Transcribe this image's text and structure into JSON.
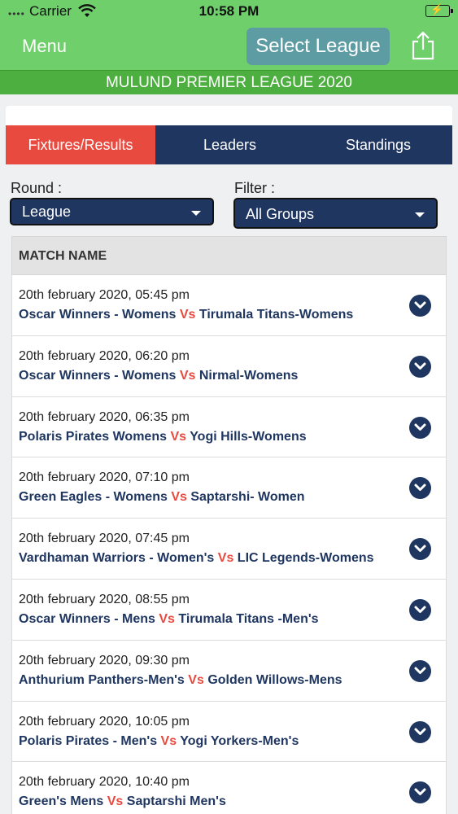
{
  "status": {
    "carrier": "Carrier",
    "time": "10:58 PM"
  },
  "nav": {
    "menu": "Menu",
    "select_league": "Select League",
    "share_icon": "share-icon"
  },
  "league_title": "MULUND PREMIER LEAGUE 2020",
  "tabs": [
    {
      "label": "Fixtures/Results",
      "active": true
    },
    {
      "label": "Leaders",
      "active": false
    },
    {
      "label": "Standings",
      "active": false
    }
  ],
  "round": {
    "label": "Round :",
    "value": "League"
  },
  "filter": {
    "label": "Filter :",
    "value": "All Groups"
  },
  "list_header": "MATCH NAME",
  "vs_label": "Vs",
  "matches": [
    {
      "date": "20th february 2020, 05:45 pm",
      "team1": "Oscar Winners - Womens",
      "team2": "Tirumala Titans-Womens"
    },
    {
      "date": "20th february 2020, 06:20 pm",
      "team1": "Oscar Winners - Womens",
      "team2": "Nirmal-Womens"
    },
    {
      "date": "20th february 2020, 06:35 pm",
      "team1": "Polaris Pirates Womens",
      "team2": "Yogi Hills-Womens"
    },
    {
      "date": "20th february 2020, 07:10 pm",
      "team1": "Green Eagles - Womens",
      "team2": "Saptarshi- Women"
    },
    {
      "date": "20th february 2020, 07:45 pm",
      "team1": "Vardhaman Warriors - Women's",
      "team2": "LIC Legends-Womens"
    },
    {
      "date": "20th february 2020, 08:55 pm",
      "team1": "Oscar Winners - Mens",
      "team2": "Tirumala Titans -Men's"
    },
    {
      "date": "20th february 2020, 09:30 pm",
      "team1": "Anthurium Panthers-Men's",
      "team2": "Golden Willows-Mens"
    },
    {
      "date": "20th february 2020, 10:05 pm",
      "team1": "Polaris Pirates - Men's",
      "team2": "Yogi Yorkers-Men's"
    },
    {
      "date": "20th february 2020, 10:40 pm",
      "team1": "Green's Mens",
      "team2": "Saptarshi Men's"
    }
  ],
  "colors": {
    "nav_green": "#6fcf6b",
    "banner_green": "#4caf3f",
    "navy": "#1f3661",
    "accent_red": "#e94a3f",
    "select_button": "#5e9ca3"
  }
}
